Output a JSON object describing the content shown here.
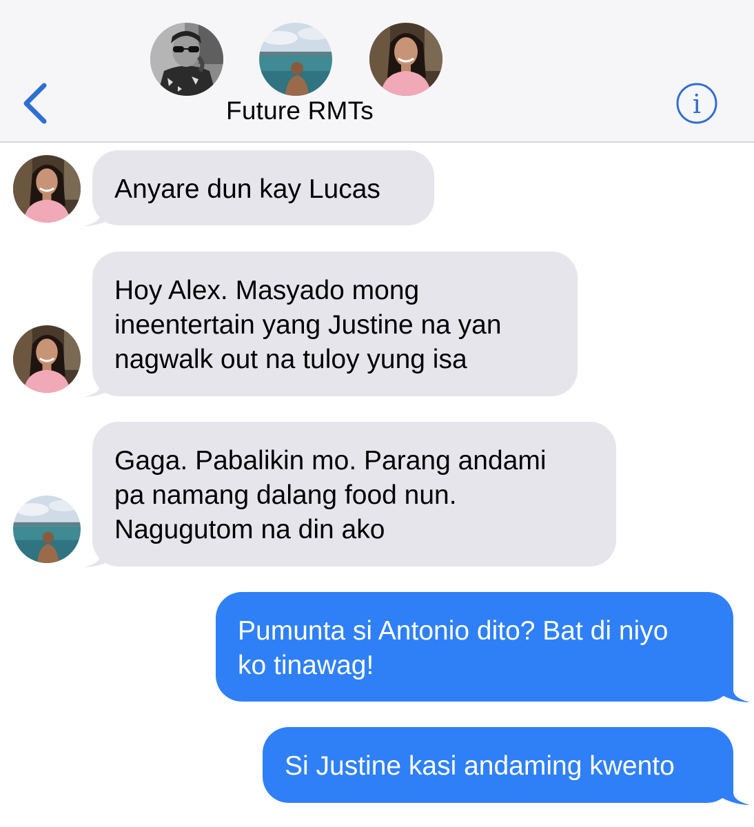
{
  "header": {
    "group_name": "Future RMTs",
    "back_icon": "chevron-left-icon",
    "info_icon": "info-icon",
    "accent_color": "#2f6fd0",
    "members": [
      {
        "name": "member-1",
        "avatar": "avatar-photo"
      },
      {
        "name": "member-2",
        "avatar": "avatar-photo"
      },
      {
        "name": "member-3",
        "avatar": "avatar-photo"
      }
    ]
  },
  "colors": {
    "incoming_bubble": "#e6e5eb",
    "outgoing_bubble": "#2f80f6",
    "header_bg": "#f6f5f7"
  },
  "messages": [
    {
      "direction": "incoming",
      "sender": "member-3",
      "text": "Anyare dun kay Lucas"
    },
    {
      "direction": "incoming",
      "sender": "member-3",
      "text": "Hoy Alex. Masyado mong\nineentertain yang Justine na yan\nnagwalk out na tuloy yung isa"
    },
    {
      "direction": "incoming",
      "sender": "member-2",
      "text": "Gaga. Pabalikin mo. Parang andami\npa namang dalang food nun.\nNagugutom na din ako"
    },
    {
      "direction": "outgoing",
      "text": "Pumunta si Antonio dito? Bat di niyo\nko tinawag!"
    },
    {
      "direction": "outgoing",
      "text": "Si Justine kasi andaming kwento"
    }
  ]
}
